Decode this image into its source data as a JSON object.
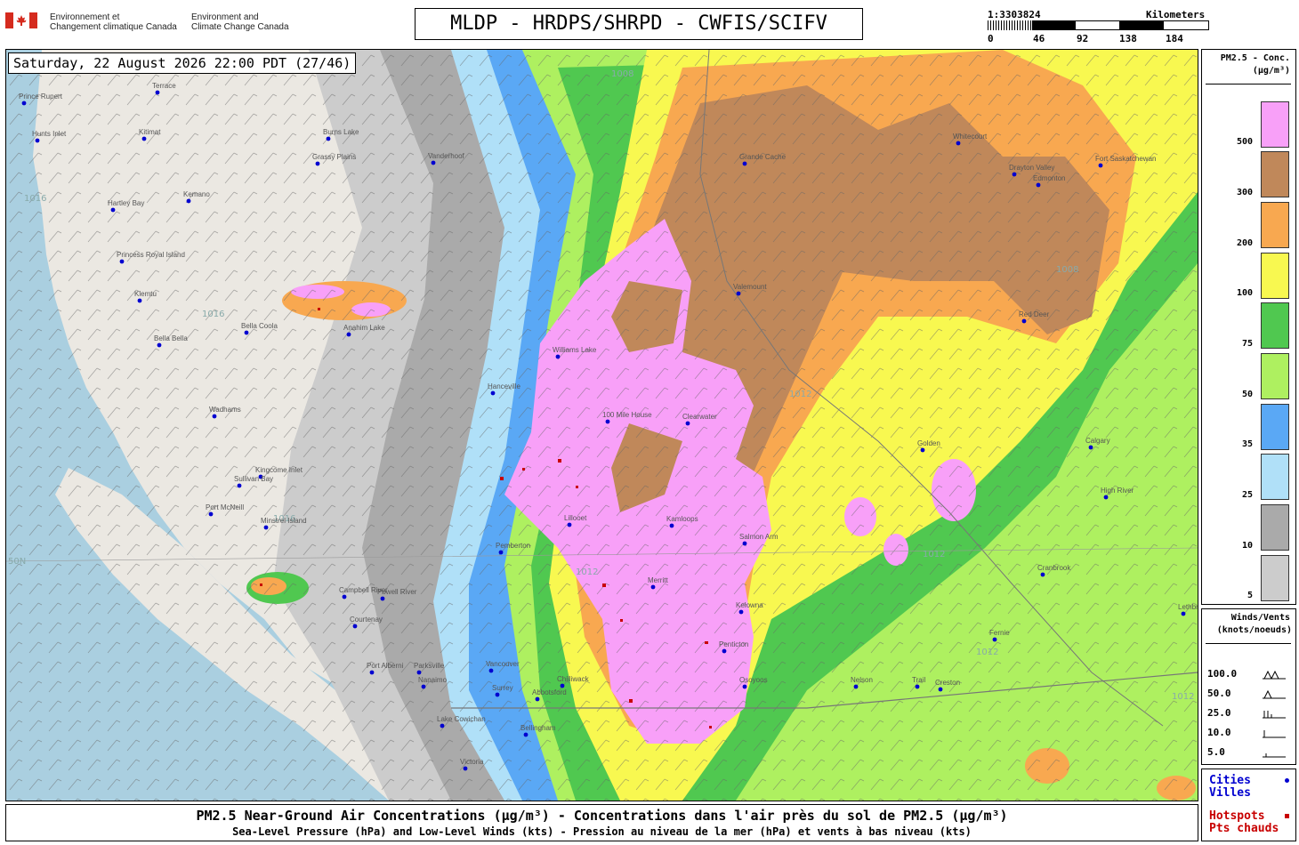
{
  "header": {
    "gov_fr_line1": "Environnement et",
    "gov_fr_line2": "Changement climatique Canada",
    "gov_en_line1": "Environment and",
    "gov_en_line2": "Climate Change Canada",
    "title": "MLDP - HRDPS/SHRPD - CWFIS/SCIFV",
    "scale": {
      "ratio": "1:3303824",
      "unit": "Kilometers",
      "ticks": [
        "0",
        "46",
        "92",
        "138",
        "184"
      ]
    }
  },
  "map": {
    "datetime": "Saturday, 22 August 2026 22:00 PDT (27/46)",
    "colors": {
      "ocean": "#aacfe0",
      "land": "#ebe8e2",
      "c5": "#cccccc",
      "c10": "#aaaaaa",
      "c25": "#b0e0f8",
      "c35": "#5aa8f5",
      "c50": "#aef060",
      "c75": "#50c850",
      "c100": "#f8f850",
      "c200": "#f8a850",
      "c300": "#c0885a",
      "c500": "#f8a0f8",
      "hotspot": "#c80000",
      "city": "#0000d0"
    },
    "cities": [
      {
        "name": "Prince Rupert"
      },
      {
        "name": "Terrace"
      },
      {
        "name": "Hunts Inlet"
      },
      {
        "name": "Kitimat"
      },
      {
        "name": "Burns Lake"
      },
      {
        "name": "Grassy Plains"
      },
      {
        "name": "Vanderhoof"
      },
      {
        "name": "Kemano"
      },
      {
        "name": "Hartley Bay"
      },
      {
        "name": "Princess Royal Island"
      },
      {
        "name": "Klemtu"
      },
      {
        "name": "Bella Coola"
      },
      {
        "name": "Bella Bella"
      },
      {
        "name": "Anahim Lake"
      },
      {
        "name": "Wadhams"
      },
      {
        "name": "Williams Lake"
      },
      {
        "name": "Hanceville"
      },
      {
        "name": "100 Mile House"
      },
      {
        "name": "Clearwater"
      },
      {
        "name": "Kingcome Inlet"
      },
      {
        "name": "Sullivan Bay"
      },
      {
        "name": "Port McNeill"
      },
      {
        "name": "Minstrel Island"
      },
      {
        "name": "Campbell River"
      },
      {
        "name": "Powell River"
      },
      {
        "name": "Courtenay"
      },
      {
        "name": "Port Alberni"
      },
      {
        "name": "Parksville"
      },
      {
        "name": "Nanaimo"
      },
      {
        "name": "Vancouver"
      },
      {
        "name": "Surrey"
      },
      {
        "name": "Abbotsford"
      },
      {
        "name": "Chilliwack"
      },
      {
        "name": "Bellingham"
      },
      {
        "name": "Lake Cowichan"
      },
      {
        "name": "Victoria"
      },
      {
        "name": "Pemberton"
      },
      {
        "name": "Lillooet"
      },
      {
        "name": "Kamloops"
      },
      {
        "name": "Merritt"
      },
      {
        "name": "Kelowna"
      },
      {
        "name": "Penticton"
      },
      {
        "name": "Osoyoos"
      },
      {
        "name": "Salmon Arm"
      },
      {
        "name": "Valemount"
      },
      {
        "name": "Grande Cache"
      },
      {
        "name": "Edmonton"
      },
      {
        "name": "Drayton Valley"
      },
      {
        "name": "Whitecourt"
      },
      {
        "name": "Fort Saskatchewan"
      },
      {
        "name": "Red Deer"
      },
      {
        "name": "Calgary"
      },
      {
        "name": "High River"
      },
      {
        "name": "Cranbrook"
      },
      {
        "name": "Fernie"
      },
      {
        "name": "Creston"
      },
      {
        "name": "Nelson"
      },
      {
        "name": "Trail"
      },
      {
        "name": "Lethbridge"
      },
      {
        "name": "Golden"
      }
    ],
    "isobars": [
      "1016",
      "1016",
      "1016",
      "1012",
      "1012",
      "1012",
      "1008",
      "1008",
      "1012",
      "1012"
    ],
    "latitude_label": "50N"
  },
  "legend": {
    "title": "PM2.5 - Conc.",
    "unit": "(µg/m³)",
    "levels": [
      "500",
      "300",
      "200",
      "100",
      "75",
      "50",
      "35",
      "25",
      "10",
      "5"
    ]
  },
  "wind_legend": {
    "title": "Winds/Vents",
    "unit": "(knots/noeuds)",
    "values": [
      "100.0",
      "50.0",
      "25.0",
      "10.0",
      "5.0"
    ]
  },
  "cities_legend": {
    "en": "Cities",
    "fr": "Villes"
  },
  "hotspots_legend": {
    "en": "Hotspots",
    "fr": "Pts chauds"
  },
  "footer": {
    "line1": "PM2.5 Near-Ground Air Concentrations (µg/m³) - Concentrations dans l'air près du sol de PM2.5 (µg/m³)",
    "line2": "Sea-Level Pressure (hPa) and Low-Level Winds (kts) - Pression au niveau de la mer (hPa) et vents à bas niveau (kts)"
  }
}
